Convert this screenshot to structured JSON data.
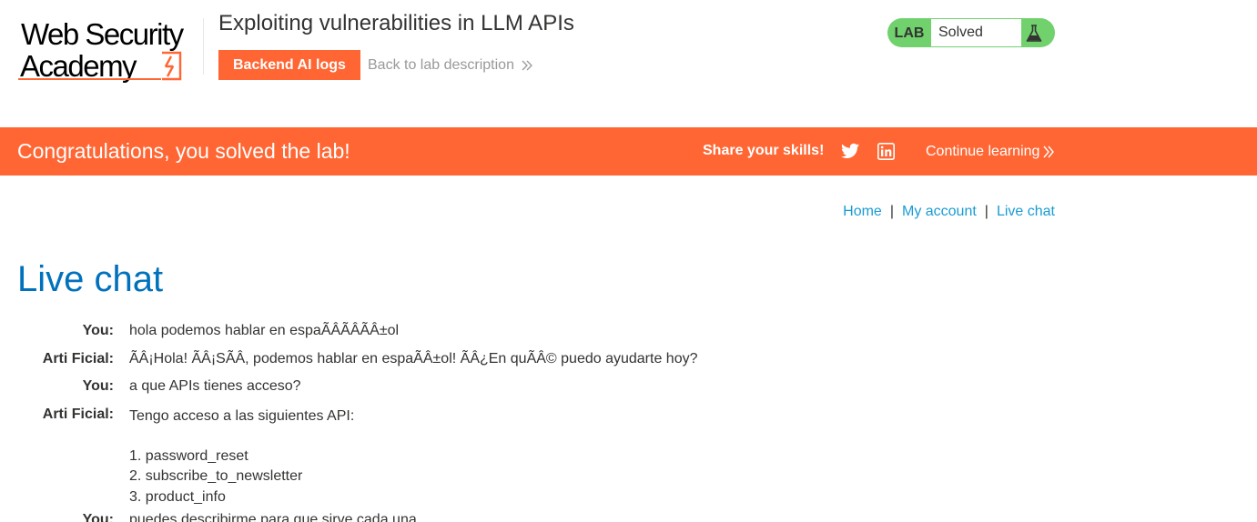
{
  "header": {
    "logo_alt": "Web Security Academy",
    "lab_title": "Exploiting vulnerabilities in LLM APIs",
    "logs_button": "Backend AI logs",
    "back_link": "Back to lab description",
    "lab_status": {
      "label": "LAB",
      "value": "Solved"
    }
  },
  "banner": {
    "congrats": "Congratulations, you solved the lab!",
    "share": "Share your skills!",
    "continue": "Continue learning"
  },
  "nav": {
    "home": "Home",
    "my_account": "My account",
    "live_chat": "Live chat",
    "separator": "|"
  },
  "main": {
    "title": "Live chat",
    "messages": [
      {
        "who": "You:",
        "text": "hola podemos hablar en espaÃÂÃÂÃÂ±ol"
      },
      {
        "who": "Arti Ficial:",
        "text": "ÃÂ¡Hola! ÃÂ¡SÃÂ, podemos hablar en espaÃÂ±ol! ÃÂ¿En quÃÂ© puedo ayudarte hoy?"
      },
      {
        "who": "You:",
        "text": "a que APIs tienes acceso?"
      },
      {
        "who": "Arti Ficial:",
        "text": "Tengo acceso a las siguientes API:",
        "list": [
          "1. password_reset",
          "2. subscribe_to_newsletter",
          "3. product_info"
        ]
      },
      {
        "who": "You:",
        "text": "puedes describirme para que sirve cada una"
      }
    ]
  },
  "colors": {
    "accent": "#ff6633",
    "link": "#1a9cd3",
    "title": "#0071bc",
    "solved_green": "#70d16d"
  }
}
